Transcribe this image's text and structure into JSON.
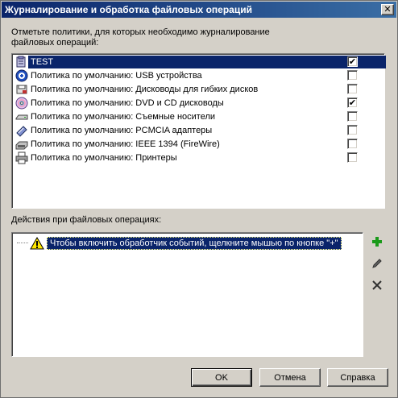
{
  "window": {
    "title": "Журналирование и обработка файловых операций",
    "close_glyph": "✕"
  },
  "policies_label": "Отметьте политики, для которых необходимо журналирование файловых операций:",
  "policies": [
    {
      "label": "TEST",
      "icon": "test-policy-icon",
      "checked": true,
      "selected": true
    },
    {
      "label": "Политика по умолчанию: USB устройства",
      "icon": "usb-icon",
      "checked": false,
      "selected": false
    },
    {
      "label": "Политика по умолчанию: Дисководы для гибких дисков",
      "icon": "floppy-icon",
      "checked": false,
      "selected": false
    },
    {
      "label": "Политика по умолчанию: DVD и CD дисководы",
      "icon": "cd-dvd-icon",
      "checked": true,
      "selected": false
    },
    {
      "label": "Политика по умолчанию: Съемные носители",
      "icon": "removable-drive-icon",
      "checked": false,
      "selected": false
    },
    {
      "label": "Политика по умолчанию: PCMCIA адаптеры",
      "icon": "pcmcia-icon",
      "checked": false,
      "selected": false
    },
    {
      "label": "Политика по умолчанию: IEEE 1394 (FireWire)",
      "icon": "firewire-icon",
      "checked": false,
      "selected": false
    },
    {
      "label": "Политика по умолчанию: Принтеры",
      "icon": "printer-icon",
      "checked": false,
      "selected": false
    }
  ],
  "check_glyph": "✔",
  "actions_label": "Действия при файловых операциях:",
  "action_hint": "Чтобы включить обработчик событий, щелкните мышью по кнопке \"+\"",
  "colors": {
    "title_bar": "#0a246a",
    "selection": "#0a246a",
    "dialog_bg": "#d4d0c8",
    "add_icon": "#1a9a1a"
  },
  "buttons": {
    "ok": "OK",
    "cancel": "Отмена",
    "help": "Справка"
  }
}
